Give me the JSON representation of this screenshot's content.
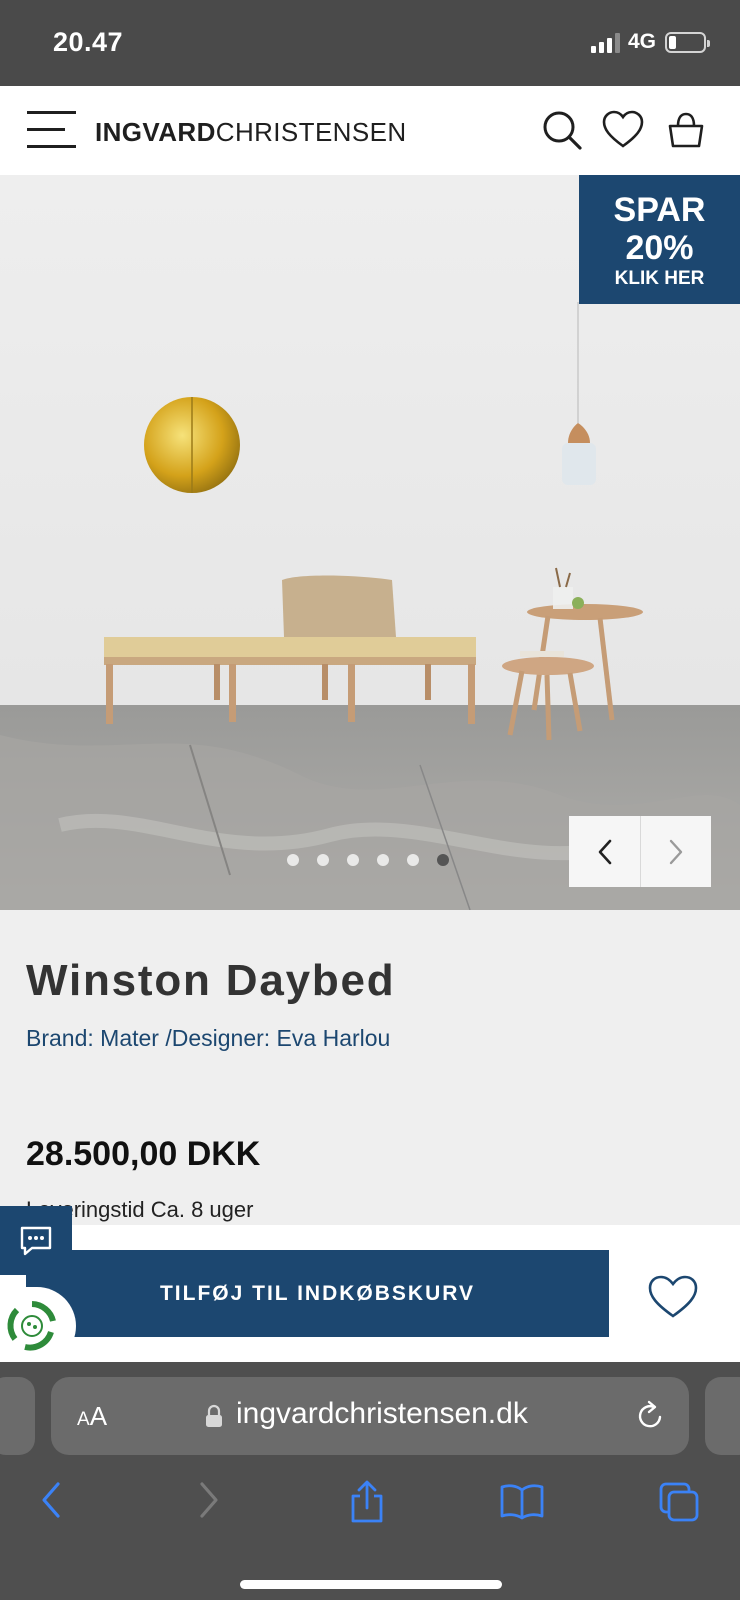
{
  "status_bar": {
    "time": "20.47",
    "network": "4G",
    "signal_bars_active": 3,
    "battery_level": 0.2
  },
  "header": {
    "logo_bold": "INGVARD",
    "logo_light": "CHRISTENSEN",
    "icons": [
      "menu-icon",
      "search-icon",
      "heart-icon",
      "basket-icon"
    ]
  },
  "hero": {
    "promo": {
      "line1": "SPAR",
      "line2": "20%",
      "line3": "KLIK HER"
    },
    "slide_count": 6,
    "active_slide": 6,
    "prev_icon": "chevron-left-icon",
    "next_icon": "chevron-right-icon"
  },
  "product": {
    "title": "Winston Daybed",
    "brand": "Brand: Mater",
    "separator": " /",
    "designer": "Designer: Eva Harlou",
    "price": "28.500,00 DKK",
    "delivery": "Leveringstid Ca. 8 uger"
  },
  "cart": {
    "add_label": "TILFØJ TIL INDKØBSKURV",
    "wishlist_icon": "heart-icon"
  },
  "widgets": {
    "chat_icon": "chat-bubble-icon",
    "eco_icon": "recycle-icon"
  },
  "browser": {
    "aa_large": "A",
    "aa_small": "A",
    "url": "ingvardchristensen.dk",
    "icons": [
      "back-icon",
      "forward-icon",
      "share-icon",
      "bookmarks-icon",
      "tabs-icon"
    ]
  },
  "colors": {
    "brand_blue": "#1c4770",
    "status_bar": "#4a4a4a",
    "safari_bar": "#4f4f4f",
    "link_blue": "#3b82f6"
  }
}
